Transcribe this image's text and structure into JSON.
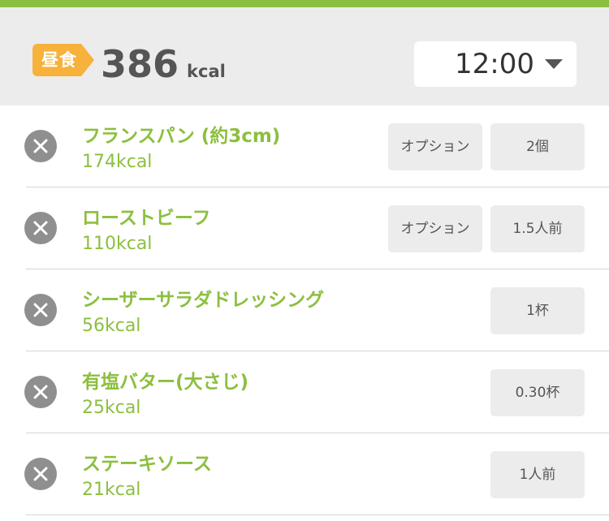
{
  "header": {
    "meal_label": "昼食",
    "total_kcal": "386",
    "kcal_unit": "kcal",
    "time": "12:00",
    "dropdown_icon": "chevron-down-icon"
  },
  "colors": {
    "accent_green": "#8cbf3f",
    "meal_tag_orange": "#f6b23a",
    "header_bg": "#ececec",
    "delete_gray": "#8f8f8f"
  },
  "items": [
    {
      "name": "フランスパン (約3cm)",
      "kcal": "174kcal",
      "option_label": "オプション",
      "quantity": "2個"
    },
    {
      "name": "ローストビーフ",
      "kcal": "110kcal",
      "option_label": "オプション",
      "quantity": "1.5人前"
    },
    {
      "name": "シーザーサラダドレッシング",
      "kcal": "56kcal",
      "quantity": "1杯"
    },
    {
      "name": "有塩バター(大さじ)",
      "kcal": "25kcal",
      "quantity": "0.30杯"
    },
    {
      "name": "ステーキソース",
      "kcal": "21kcal",
      "quantity": "1人前"
    }
  ]
}
